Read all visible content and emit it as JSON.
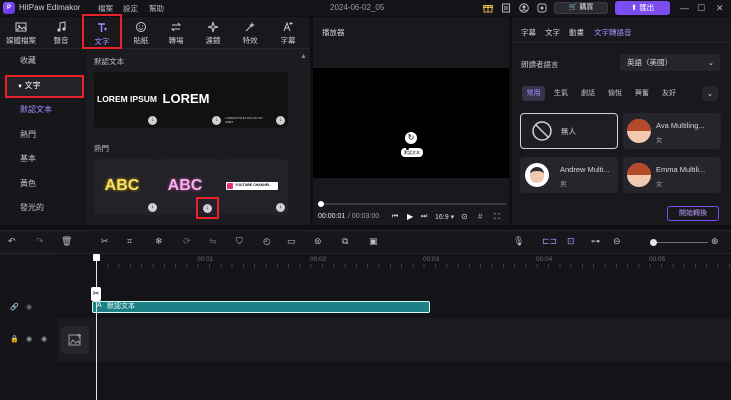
{
  "titlebar": {
    "app_name": "HitPaw Edimakor",
    "menus": [
      "檔案",
      "設定",
      "幫助"
    ],
    "date": "2024-06-02_05",
    "shop_label": "購買",
    "export_label": "匯出",
    "logo_text": "P"
  },
  "media_tabs": [
    {
      "label": "媒體檔案",
      "icon": "media-icon"
    },
    {
      "label": "聲音",
      "icon": "music-icon"
    },
    {
      "label": "文字",
      "icon": "text-icon",
      "active": true
    },
    {
      "label": "貼紙",
      "icon": "sticker-icon"
    },
    {
      "label": "轉場",
      "icon": "transition-icon"
    },
    {
      "label": "濾鏡",
      "icon": "filter-icon"
    },
    {
      "label": "特效",
      "icon": "effects-icon"
    },
    {
      "label": "字幕",
      "icon": "subtitle-icon"
    }
  ],
  "sidebar": {
    "items": [
      {
        "label": "收藏"
      },
      {
        "label": "文字"
      },
      {
        "label": "默認文本"
      },
      {
        "label": "熱門"
      },
      {
        "label": "基本"
      },
      {
        "label": "黃色"
      },
      {
        "label": "發光的"
      }
    ]
  },
  "content": {
    "section_default": "默認文本",
    "section_popular": "熱門",
    "tiles_row1": [
      "LOREM IPSUM",
      "LOREM",
      "LOREM IPSUM DOLOR SIT AMET"
    ],
    "tiles_row2": [
      "ABC",
      "ABC",
      "YOUTUBE CHANNEL"
    ],
    "download_glyph": "↓"
  },
  "player": {
    "label": "播放器",
    "current_time": "00:00:01",
    "total_time": "/ 00:03:00",
    "aspect": "16:9",
    "text_overlay": "默認文本"
  },
  "right_panel": {
    "tabs": [
      "字幕",
      "文字",
      "動畫",
      "文字轉語音"
    ],
    "active_tab": 3,
    "voice_lang_label": "朗讀者語言",
    "voice_lang_value": "英語（美國）",
    "chips": [
      "常用",
      "生氣",
      "劇話",
      "愉悅",
      "興奮",
      "友好"
    ],
    "voices": [
      {
        "name": "無人",
        "sub": ""
      },
      {
        "name": "Ava Multiling...",
        "sub": "女"
      },
      {
        "name": "Andrew Multi...",
        "sub": "男"
      },
      {
        "name": "Emma Multili...",
        "sub": "女"
      }
    ],
    "convert_label": "開始轉換"
  },
  "timeline": {
    "ruler_labels": [
      "00:00",
      "00:01",
      "00:02",
      "00:03",
      "00:04",
      "00:05"
    ],
    "clip_label": "默認文本"
  },
  "colors": {
    "accent": "#7b4cf0",
    "accent_text": "#a98bff",
    "clip": "#1f7f86",
    "highlight_box": "#e8222b"
  }
}
